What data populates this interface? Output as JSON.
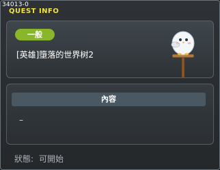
{
  "window": {
    "quest_id": "34013-0",
    "title": "QUEST INFO"
  },
  "quest": {
    "badge": "一般",
    "name": "[英雄]墮落的世界树2"
  },
  "content": {
    "header": "內容",
    "body": "–"
  },
  "status": {
    "label": "狀態:",
    "value": "可開始"
  },
  "colors": {
    "title": "#f0e43c",
    "badge": "#8ab62b",
    "header_bar": "#4a5864"
  },
  "icons": {
    "mascot": "white-bird-on-signpost-icon"
  }
}
